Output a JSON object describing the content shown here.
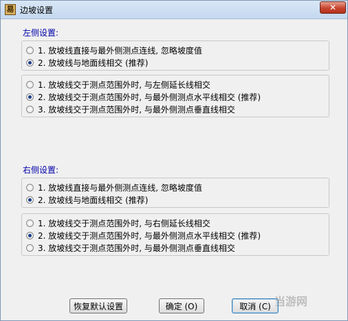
{
  "window": {
    "title": "边坡设置",
    "app_icon": "surveying-app-icon",
    "close_glyph": "✕"
  },
  "left": {
    "label": "左侧设置:",
    "group1": [
      {
        "label": "1. 放坡线直接与最外侧测点连线, 忽略坡度值",
        "checked": false
      },
      {
        "label": "2. 放坡线与地面线相交 (推荐)",
        "checked": true
      }
    ],
    "group2": [
      {
        "label": "1. 放坡线交于测点范围外时, 与左侧延长线相交",
        "checked": false
      },
      {
        "label": "2. 放坡线交于测点范围外时, 与最外侧测点水平线相交 (推荐)",
        "checked": true
      },
      {
        "label": "3. 放坡线交于测点范围外时, 与最外侧测点垂直线相交",
        "checked": false
      }
    ]
  },
  "right": {
    "label": "右侧设置:",
    "group1": [
      {
        "label": "1. 放坡线直接与最外侧测点连线, 忽略坡度值",
        "checked": false
      },
      {
        "label": "2. 放坡线与地面线相交 (推荐)",
        "checked": true
      }
    ],
    "group2": [
      {
        "label": "1. 放坡线交于测点范围外时, 与右侧延长线相交",
        "checked": false
      },
      {
        "label": "2. 放坡线交于测点范围外时, 与最外侧测点水平线相交 (推荐)",
        "checked": true
      },
      {
        "label": "3. 放坡线交于测点范围外时, 与最外侧测点垂直线相交",
        "checked": false
      }
    ]
  },
  "buttons": {
    "restore_defaults": "恢复默认设置",
    "ok": "确定 (O)",
    "cancel": "取消 (C)"
  },
  "watermark": "当游网"
}
